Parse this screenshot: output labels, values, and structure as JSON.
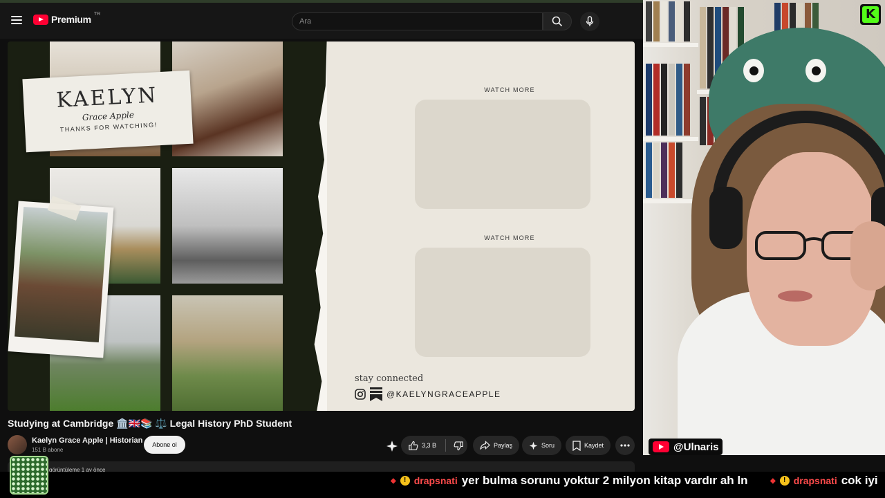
{
  "header": {
    "premium_label": "Premium",
    "region_label": "TR",
    "search_placeholder": "Ara"
  },
  "player": {
    "note_name": "KAELYN",
    "note_script": "Grace Apple",
    "note_thanks": "THANKS FOR WATCHING!",
    "watch_more_1": "WATCH MORE",
    "watch_more_2": "WATCH MORE",
    "stay_connected": "stay connected",
    "handle": "@KAELYNGRACEAPPLE"
  },
  "video": {
    "title": "Studying at Cambridge 🏛️🇬🇧📚 ⚖️ Legal History PhD Student",
    "channel_name": "Kaelyn Grace Apple | Historian",
    "subscribers": "151 B abone",
    "subscribe_label": "Abone ol",
    "like_count": "3,3 B",
    "share_label": "Paylaş",
    "ask_label": "Soru",
    "save_label": "Kaydet",
    "description_snippet": "görüntüleme  1 ay önce"
  },
  "overlay": {
    "youtube_handle": "@Ulnaris",
    "kick_logo": "K"
  },
  "chat": {
    "messages": [
      {
        "user": "drapsnati",
        "text": "yer bulma sorunu yoktur 2 milyon kitap vardır ah ln"
      },
      {
        "user": "drapsnati",
        "text": "cok iyi"
      }
    ]
  },
  "colors": {
    "youtube_red": "#ff0033",
    "kick_green": "#53fc18",
    "chat_user": "#ff4b4b"
  }
}
